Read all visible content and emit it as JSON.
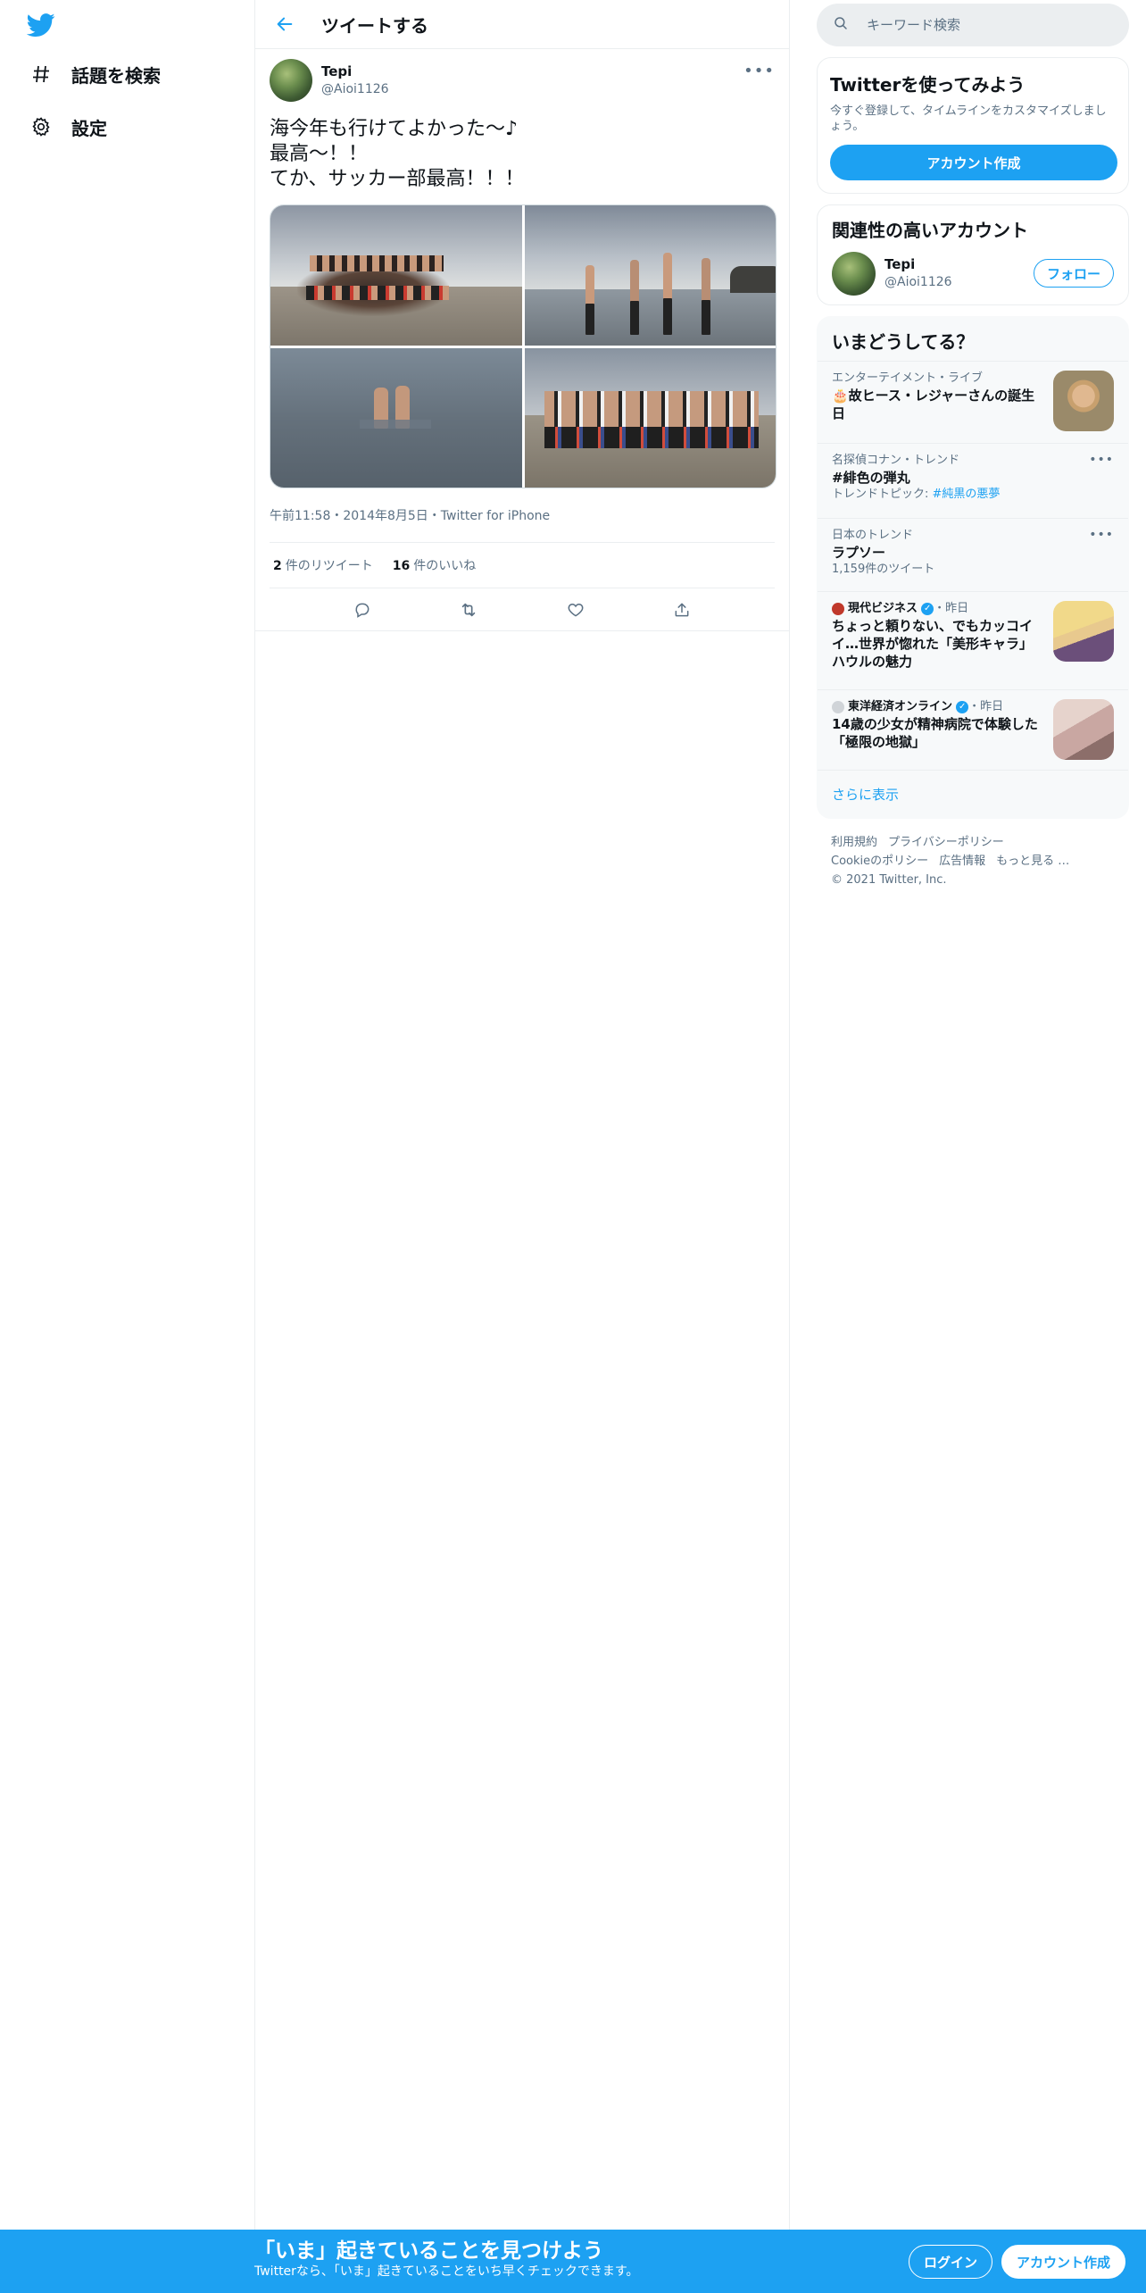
{
  "nav": {
    "logo": "twitter-bird-icon",
    "items": [
      {
        "label": "話題を検索",
        "icon": "hashtag-icon"
      },
      {
        "label": "設定",
        "icon": "gear-icon"
      }
    ]
  },
  "header": {
    "title": "ツイートする"
  },
  "tweet": {
    "user_name": "Tepi",
    "handle": "@Aioi1126",
    "text": "海今年も行けてよかった〜♪\n最高〜！！\nてか、サッカー部最高！！！",
    "meta": "午前11:58・2014年8月5日・Twitter for iPhone",
    "retweets": {
      "count": "2",
      "label": "件のリツイート"
    },
    "likes": {
      "count": "16",
      "label": "件のいいね"
    },
    "photo_count": 4
  },
  "search": {
    "placeholder": "キーワード検索"
  },
  "signup": {
    "title": "Twitterを使ってみよう",
    "desc": "今すぐ登録して、タイムラインをカスタマイズしましょう。",
    "button": "アカウント作成"
  },
  "related": {
    "title": "関連性の高いアカウント",
    "user_name": "Tepi",
    "handle": "@Aioi1126",
    "follow": "フォロー"
  },
  "trends": {
    "title": "いまどうしてる？",
    "items": [
      {
        "ctx": "エンターテイメント・ライブ",
        "title": "🎂故ヒース・レジャーさんの誕生日"
      },
      {
        "ctx": "名探偵コナン・トレンド",
        "title": "#緋色の弾丸",
        "sub_prefix": "トレンドトピック: ",
        "sub_link": "#純黒の悪夢"
      },
      {
        "ctx": "日本のトレンド",
        "title": "ラプソー",
        "sub": "1,159件のツイート"
      },
      {
        "source": "現代ビジネス",
        "time": "・昨日",
        "title": "ちょっと頼りない、でもカッコイイ…世界が惚れた「美形キャラ」ハウルの魅力"
      },
      {
        "source": "東洋経済オンライン",
        "time": "・昨日",
        "title": "14歳の少女が精神病院で体験した「極限の地獄」"
      }
    ],
    "show_more": "さらに表示"
  },
  "footer": {
    "links": [
      "利用規約",
      "プライバシーポリシー",
      "Cookieのポリシー",
      "広告情報",
      "もっと見る …"
    ],
    "copyright": "© 2021 Twitter, Inc."
  },
  "banner": {
    "title": "「いま」起きていることを見つけよう",
    "sub": "Twitterなら、「いま」起きていることをいち早くチェックできます。",
    "login": "ログイン",
    "signup": "アカウント作成"
  },
  "colors": {
    "accent": "#1da1f2",
    "text": "#0f1419",
    "muted": "#5b7083"
  }
}
